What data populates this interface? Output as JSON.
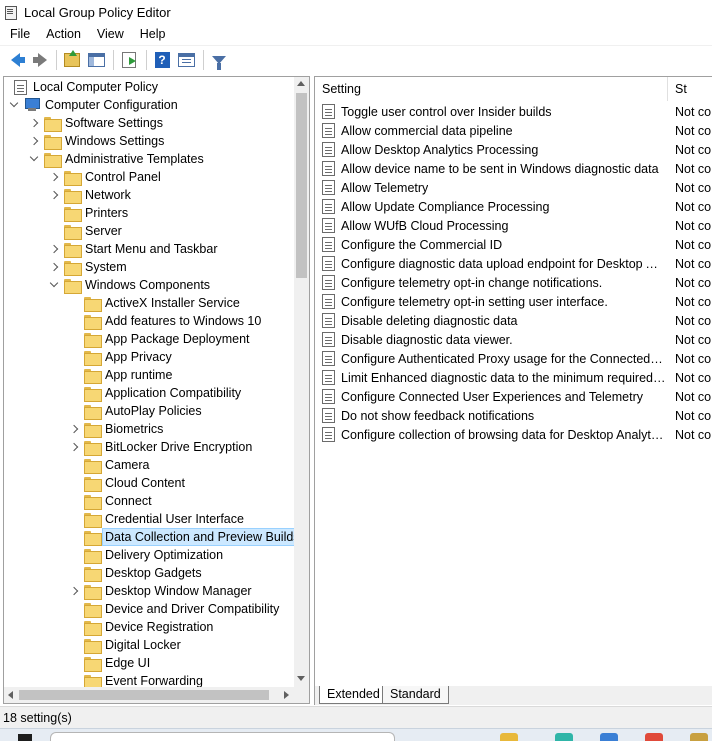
{
  "window": {
    "title": "Local Group Policy Editor"
  },
  "menu": [
    "File",
    "Action",
    "View",
    "Help"
  ],
  "toolbar": {
    "back": "back-arrow-icon",
    "forward": "forward-arrow-icon",
    "up": "up-folder-icon",
    "show_hide_tree": "show-hide-tree-icon",
    "export": "export-list-icon",
    "help": "?",
    "properties": "properties-icon",
    "filter": "filter-icon"
  },
  "tree": [
    {
      "label": "Local Computer Policy",
      "level": 0,
      "icon": "doc",
      "expander": "none"
    },
    {
      "label": "Computer Configuration",
      "level": 0,
      "icon": "computer",
      "expander": "open"
    },
    {
      "label": "Software Settings",
      "level": 1,
      "icon": "folder",
      "expander": "closed"
    },
    {
      "label": "Windows Settings",
      "level": 1,
      "icon": "folder",
      "expander": "closed"
    },
    {
      "label": "Administrative Templates",
      "level": 1,
      "icon": "folder",
      "expander": "open"
    },
    {
      "label": "Control Panel",
      "level": 2,
      "icon": "folder",
      "expander": "closed"
    },
    {
      "label": "Network",
      "level": 2,
      "icon": "folder",
      "expander": "closed"
    },
    {
      "label": "Printers",
      "level": 2,
      "icon": "folder",
      "expander": "none"
    },
    {
      "label": "Server",
      "level": 2,
      "icon": "folder",
      "expander": "none"
    },
    {
      "label": "Start Menu and Taskbar",
      "level": 2,
      "icon": "folder",
      "expander": "closed"
    },
    {
      "label": "System",
      "level": 2,
      "icon": "folder",
      "expander": "closed"
    },
    {
      "label": "Windows Components",
      "level": 2,
      "icon": "folder",
      "expander": "open"
    },
    {
      "label": "ActiveX Installer Service",
      "level": 3,
      "icon": "folder",
      "expander": "none"
    },
    {
      "label": "Add features to Windows 10",
      "level": 3,
      "icon": "folder",
      "expander": "none"
    },
    {
      "label": "App Package Deployment",
      "level": 3,
      "icon": "folder",
      "expander": "none"
    },
    {
      "label": "App Privacy",
      "level": 3,
      "icon": "folder",
      "expander": "none"
    },
    {
      "label": "App runtime",
      "level": 3,
      "icon": "folder",
      "expander": "none"
    },
    {
      "label": "Application Compatibility",
      "level": 3,
      "icon": "folder",
      "expander": "none"
    },
    {
      "label": "AutoPlay Policies",
      "level": 3,
      "icon": "folder",
      "expander": "none"
    },
    {
      "label": "Biometrics",
      "level": 3,
      "icon": "folder",
      "expander": "closed"
    },
    {
      "label": "BitLocker Drive Encryption",
      "level": 3,
      "icon": "folder",
      "expander": "closed"
    },
    {
      "label": "Camera",
      "level": 3,
      "icon": "folder",
      "expander": "none"
    },
    {
      "label": "Cloud Content",
      "level": 3,
      "icon": "folder",
      "expander": "none"
    },
    {
      "label": "Connect",
      "level": 3,
      "icon": "folder",
      "expander": "none"
    },
    {
      "label": "Credential User Interface",
      "level": 3,
      "icon": "folder",
      "expander": "none"
    },
    {
      "label": "Data Collection and Preview Builds",
      "level": 3,
      "icon": "folder",
      "expander": "none",
      "selected": true
    },
    {
      "label": "Delivery Optimization",
      "level": 3,
      "icon": "folder",
      "expander": "none"
    },
    {
      "label": "Desktop Gadgets",
      "level": 3,
      "icon": "folder",
      "expander": "none"
    },
    {
      "label": "Desktop Window Manager",
      "level": 3,
      "icon": "folder",
      "expander": "closed"
    },
    {
      "label": "Device and Driver Compatibility",
      "level": 3,
      "icon": "folder",
      "expander": "none"
    },
    {
      "label": "Device Registration",
      "level": 3,
      "icon": "folder",
      "expander": "none"
    },
    {
      "label": "Digital Locker",
      "level": 3,
      "icon": "folder",
      "expander": "none"
    },
    {
      "label": "Edge UI",
      "level": 3,
      "icon": "folder",
      "expander": "none"
    },
    {
      "label": "Event Forwarding",
      "level": 3,
      "icon": "folder",
      "expander": "none"
    }
  ],
  "list": {
    "columns": {
      "setting": "Setting",
      "state": "St"
    },
    "rows": [
      {
        "setting": "Toggle user control over Insider builds",
        "state": "Not co"
      },
      {
        "setting": "Allow commercial data pipeline",
        "state": "Not co"
      },
      {
        "setting": "Allow Desktop Analytics Processing",
        "state": "Not co"
      },
      {
        "setting": "Allow device name to be sent in Windows diagnostic data",
        "state": "Not co"
      },
      {
        "setting": "Allow Telemetry",
        "state": "Not co"
      },
      {
        "setting": "Allow Update Compliance Processing",
        "state": "Not co"
      },
      {
        "setting": "Allow WUfB Cloud Processing",
        "state": "Not co"
      },
      {
        "setting": "Configure the Commercial ID",
        "state": "Not co"
      },
      {
        "setting": "Configure diagnostic data upload endpoint for Desktop Ana...",
        "state": "Not co"
      },
      {
        "setting": "Configure telemetry opt-in change notifications.",
        "state": "Not co"
      },
      {
        "setting": "Configure telemetry opt-in setting user interface.",
        "state": "Not co"
      },
      {
        "setting": "Disable deleting diagnostic data",
        "state": "Not co"
      },
      {
        "setting": "Disable diagnostic data viewer.",
        "state": "Not co"
      },
      {
        "setting": "Configure Authenticated Proxy usage for the Connected Us...",
        "state": "Not co"
      },
      {
        "setting": "Limit Enhanced diagnostic data to the minimum required b...",
        "state": "Not co"
      },
      {
        "setting": "Configure Connected User Experiences and Telemetry",
        "state": "Not co"
      },
      {
        "setting": "Do not show feedback notifications",
        "state": "Not co"
      },
      {
        "setting": "Configure collection of browsing data for Desktop Analytics",
        "state": "Not co"
      }
    ]
  },
  "tabs": [
    "Extended",
    "Standard"
  ],
  "status": {
    "text": "18 setting(s)"
  },
  "colors": {
    "selection_bg": "#cce8ff",
    "selection_border": "#99d1ff",
    "folder": "#f7d774",
    "accent": "#2d7fd3"
  }
}
